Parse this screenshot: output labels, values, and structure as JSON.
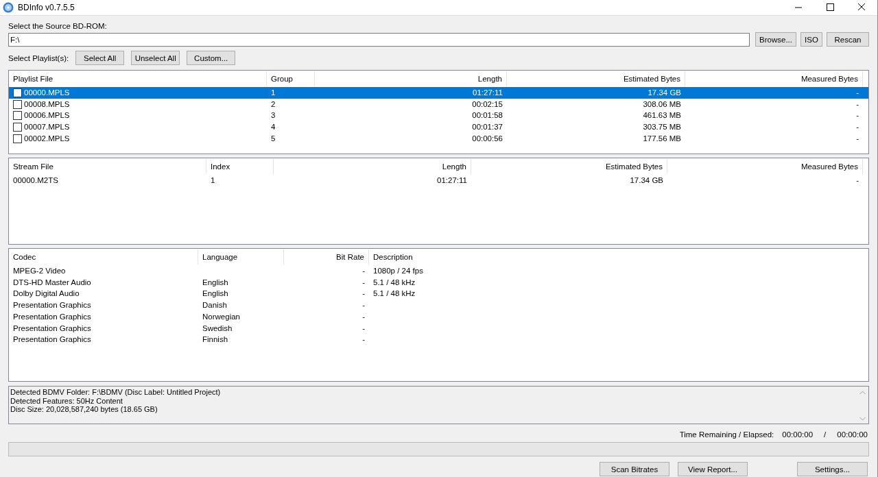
{
  "window": {
    "title": "BDInfo v0.7.5.5"
  },
  "source": {
    "label": "Select the Source BD-ROM:",
    "value": "F:\\",
    "buttons": [
      "Browse...",
      "ISO",
      "Rescan"
    ]
  },
  "playlist_select": {
    "label": "Select Playlist(s):",
    "buttons": [
      "Select All",
      "Unselect All",
      "Custom..."
    ]
  },
  "playlists": {
    "columns": [
      "Playlist File",
      "Group",
      "Length",
      "Estimated Bytes",
      "Measured Bytes"
    ],
    "rows": [
      {
        "file": "00000.MPLS",
        "group": "1",
        "length": "01:27:11",
        "estimated": "17.34 GB",
        "measured": "-",
        "checked": false,
        "selected": true
      },
      {
        "file": "00008.MPLS",
        "group": "2",
        "length": "00:02:15",
        "estimated": "308.06 MB",
        "measured": "-",
        "checked": false,
        "selected": false
      },
      {
        "file": "00006.MPLS",
        "group": "3",
        "length": "00:01:58",
        "estimated": "461.63 MB",
        "measured": "-",
        "checked": false,
        "selected": false
      },
      {
        "file": "00007.MPLS",
        "group": "4",
        "length": "00:01:37",
        "estimated": "303.75 MB",
        "measured": "-",
        "checked": false,
        "selected": false
      },
      {
        "file": "00002.MPLS",
        "group": "5",
        "length": "00:00:56",
        "estimated": "177.56 MB",
        "measured": "-",
        "checked": false,
        "selected": false
      }
    ]
  },
  "streams": {
    "columns": [
      "Stream File",
      "Index",
      "Length",
      "Estimated Bytes",
      "Measured Bytes"
    ],
    "rows": [
      {
        "file": "00000.M2TS",
        "index": "1",
        "length": "01:27:11",
        "estimated": "17.34 GB",
        "measured": "-"
      }
    ]
  },
  "codecs": {
    "columns": [
      "Codec",
      "Language",
      "Bit Rate",
      "Description"
    ],
    "rows": [
      {
        "codec": "MPEG-2 Video",
        "language": "",
        "bitrate": "-",
        "description": "1080p / 24 fps"
      },
      {
        "codec": "DTS-HD Master Audio",
        "language": "English",
        "bitrate": "-",
        "description": "5.1 / 48 kHz"
      },
      {
        "codec": "Dolby Digital Audio",
        "language": "English",
        "bitrate": "-",
        "description": "5.1 / 48 kHz"
      },
      {
        "codec": "Presentation Graphics",
        "language": "Danish",
        "bitrate": "-",
        "description": ""
      },
      {
        "codec": "Presentation Graphics",
        "language": "Norwegian",
        "bitrate": "-",
        "description": ""
      },
      {
        "codec": "Presentation Graphics",
        "language": "Swedish",
        "bitrate": "-",
        "description": ""
      },
      {
        "codec": "Presentation Graphics",
        "language": "Finnish",
        "bitrate": "-",
        "description": ""
      }
    ]
  },
  "info": [
    "Detected BDMV Folder: F:\\BDMV (Disc Label: Untitled Project)",
    "Detected Features: 50Hz Content",
    "Disc Size: 20,028,587,240 bytes (18.65 GB)"
  ],
  "time": {
    "label": "Time Remaining / Elapsed:",
    "remaining": "00:00:00",
    "separator": "/",
    "elapsed": "00:00:00"
  },
  "progress": {
    "level": 0
  },
  "bottom_buttons": [
    "Scan Bitrates",
    "View Report...",
    "Settings..."
  ]
}
